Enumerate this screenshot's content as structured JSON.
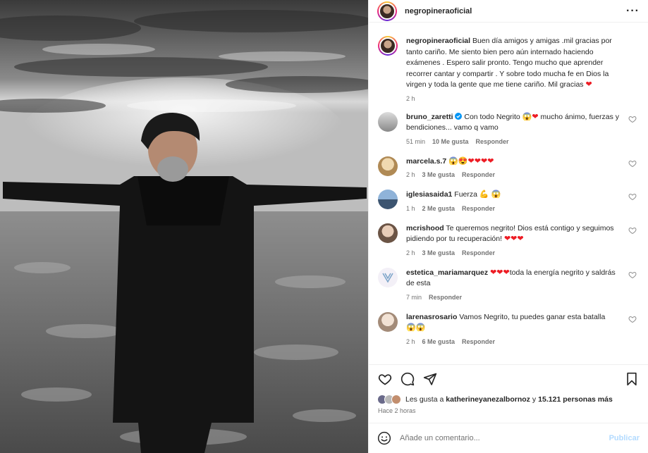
{
  "post": {
    "username": "negropineraoficial",
    "more_icon": "more-dots-icon"
  },
  "caption": {
    "username": "negropineraoficial",
    "text": "Buen día amigos y amigas .mil gracias por tanto cariño. Me siento bien pero aún internado haciendo exámenes . Espero salir pronto. Tengo mucho que aprender recorrer cantar y compartir . Y sobre todo mucha fe en Dios la virgen y toda la gente que me tiene cariño. Mil gracias",
    "time": "2 h"
  },
  "comments": [
    {
      "username": "bruno_zaretti",
      "verified": true,
      "text_a": "Con todo Negrito",
      "text_b": "mucho ánimo, fuerzas y bendiciones... vamo q vamo",
      "time": "51 min",
      "likes": "10 Me gusta",
      "reply": "Responder"
    },
    {
      "username": "marcela.s.7",
      "text": "",
      "time": "2 h",
      "likes": "3 Me gusta",
      "reply": "Responder"
    },
    {
      "username": "iglesiasaida1",
      "text": "Fuerza",
      "time": "1 h",
      "likes": "2 Me gusta",
      "reply": "Responder"
    },
    {
      "username": "mcrishood",
      "text": "Te queremos negrito! Dios está contigo y seguimos pidiendo por tu recuperación!",
      "time": "2 h",
      "likes": "3 Me gusta",
      "reply": "Responder"
    },
    {
      "username": "estetica_mariamarquez",
      "text": "toda la energía negrito y saldrás de esta",
      "time": "7 min",
      "reply": "Responder"
    },
    {
      "username": "larenasrosario",
      "text": "Vamos Negrito, tu puedes ganar esta batalla",
      "time": "2 h",
      "likes": "6 Me gusta",
      "reply": "Responder"
    }
  ],
  "likes_line": {
    "prefix": "Les gusta a",
    "user": "katherineyanezalbornoz",
    "middle": "y",
    "count": "15.121 personas más"
  },
  "posted": "Hace 2 horas",
  "composer": {
    "placeholder": "Añade un comentario...",
    "submit": "Publicar"
  },
  "colors": {
    "heart": "#ed1c24",
    "verified": "#0095f6",
    "muted": "#737373",
    "publish_disabled": "#b3dbff"
  }
}
